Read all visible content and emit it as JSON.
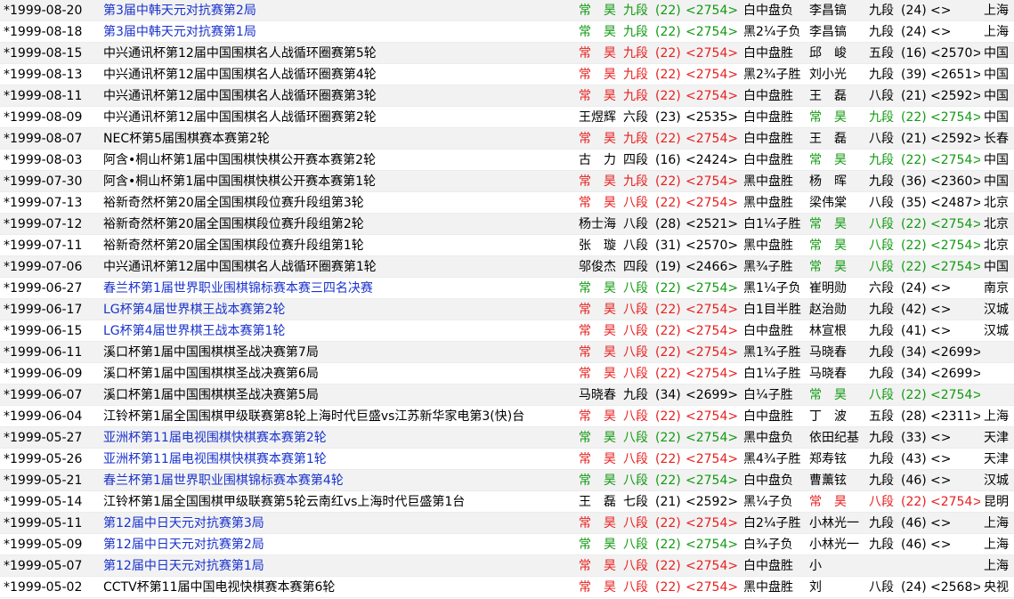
{
  "colors": {
    "link": "#1a33cc",
    "red_highlight": "#e8201f",
    "green_highlight": "#119a11",
    "row_alt": "#f2f2f2"
  },
  "rows": [
    {
      "date": "*1999-08-20",
      "event": "第3届中韩天元对抗赛第2局",
      "link": true,
      "black": {
        "name": "常　昊",
        "rank": "九段",
        "num": "(22)",
        "elo": "<2754>",
        "hl": "green"
      },
      "result": "白中盘负",
      "white": {
        "name": "李昌镐",
        "rank": "九段",
        "num": "(24)",
        "elo": "<>",
        "hl": ""
      },
      "place": "上海"
    },
    {
      "date": "*1999-08-18",
      "event": "第3届中韩天元对抗赛第1局",
      "link": true,
      "black": {
        "name": "常　昊",
        "rank": "九段",
        "num": "(22)",
        "elo": "<2754>",
        "hl": "green"
      },
      "result": "黑2¼子负",
      "white": {
        "name": "李昌镐",
        "rank": "九段",
        "num": "(24)",
        "elo": "<>",
        "hl": ""
      },
      "place": "上海"
    },
    {
      "date": "*1999-08-15",
      "event": "中兴通讯杯第12届中国围棋名人战循环圈赛第5轮",
      "link": false,
      "black": {
        "name": "常　昊",
        "rank": "九段",
        "num": "(22)",
        "elo": "<2754>",
        "hl": "red"
      },
      "result": "白中盘胜",
      "white": {
        "name": "邱　峻",
        "rank": "五段",
        "num": "(16)",
        "elo": "<2570>",
        "hl": ""
      },
      "place": "中国"
    },
    {
      "date": "*1999-08-13",
      "event": "中兴通讯杯第12届中国围棋名人战循环圈赛第4轮",
      "link": false,
      "black": {
        "name": "常　昊",
        "rank": "九段",
        "num": "(22)",
        "elo": "<2754>",
        "hl": "red"
      },
      "result": "黑2¾子胜",
      "white": {
        "name": "刘小光",
        "rank": "九段",
        "num": "(39)",
        "elo": "<2651>",
        "hl": ""
      },
      "place": "中国"
    },
    {
      "date": "*1999-08-11",
      "event": "中兴通讯杯第12届中国围棋名人战循环圈赛第3轮",
      "link": false,
      "black": {
        "name": "常　昊",
        "rank": "九段",
        "num": "(22)",
        "elo": "<2754>",
        "hl": "red"
      },
      "result": "白中盘胜",
      "white": {
        "name": "王　磊",
        "rank": "八段",
        "num": "(21)",
        "elo": "<2592>",
        "hl": ""
      },
      "place": "中国"
    },
    {
      "date": "*1999-08-09",
      "event": "中兴通讯杯第12届中国围棋名人战循环圈赛第2轮",
      "link": false,
      "black": {
        "name": "王煜辉",
        "rank": "六段",
        "num": "(23)",
        "elo": "<2535>",
        "hl": ""
      },
      "result": "白中盘胜",
      "white": {
        "name": "常　昊",
        "rank": "九段",
        "num": "(22)",
        "elo": "<2754>",
        "hl": "green"
      },
      "place": "中国"
    },
    {
      "date": "*1999-08-07",
      "event": "NEC杯第5届围棋赛本赛第2轮",
      "link": false,
      "black": {
        "name": "常　昊",
        "rank": "九段",
        "num": "(22)",
        "elo": "<2754>",
        "hl": "red"
      },
      "result": "白中盘胜",
      "white": {
        "name": "王　磊",
        "rank": "八段",
        "num": "(21)",
        "elo": "<2592>",
        "hl": ""
      },
      "place": "长春"
    },
    {
      "date": "*1999-08-03",
      "event": "阿含•桐山杯第1届中国围棋快棋公开赛本赛第2轮",
      "link": false,
      "black": {
        "name": "古　力",
        "rank": "四段",
        "num": "(16)",
        "elo": "<2424>",
        "hl": ""
      },
      "result": "白中盘胜",
      "white": {
        "name": "常　昊",
        "rank": "九段",
        "num": "(22)",
        "elo": "<2754>",
        "hl": "green"
      },
      "place": "中国"
    },
    {
      "date": "*1999-07-30",
      "event": "阿含•桐山杯第1届中国围棋快棋公开赛本赛第1轮",
      "link": false,
      "black": {
        "name": "常　昊",
        "rank": "九段",
        "num": "(22)",
        "elo": "<2754>",
        "hl": "red"
      },
      "result": "黑中盘胜",
      "white": {
        "name": "杨　晖",
        "rank": "九段",
        "num": "(36)",
        "elo": "<2360>",
        "hl": ""
      },
      "place": "中国"
    },
    {
      "date": "*1999-07-13",
      "event": "裕新奇然杯第20届全国围棋段位赛升段组第3轮",
      "link": false,
      "black": {
        "name": "常　昊",
        "rank": "八段",
        "num": "(22)",
        "elo": "<2754>",
        "hl": "red"
      },
      "result": "黑中盘胜",
      "white": {
        "name": "梁伟棠",
        "rank": "八段",
        "num": "(35)",
        "elo": "<2487>",
        "hl": ""
      },
      "place": "北京"
    },
    {
      "date": "*1999-07-12",
      "event": "裕新奇然杯第20届全国围棋段位赛升段组第2轮",
      "link": false,
      "black": {
        "name": "杨士海",
        "rank": "八段",
        "num": "(28)",
        "elo": "<2521>",
        "hl": ""
      },
      "result": "白1¼子胜",
      "white": {
        "name": "常　昊",
        "rank": "八段",
        "num": "(22)",
        "elo": "<2754>",
        "hl": "green"
      },
      "place": "北京"
    },
    {
      "date": "*1999-07-11",
      "event": "裕新奇然杯第20届全国围棋段位赛升段组第1轮",
      "link": false,
      "black": {
        "name": "张　璇",
        "rank": "八段",
        "num": "(31)",
        "elo": "<2570>",
        "hl": ""
      },
      "result": "黑中盘胜",
      "white": {
        "name": "常　昊",
        "rank": "八段",
        "num": "(22)",
        "elo": "<2754>",
        "hl": "green"
      },
      "place": "北京"
    },
    {
      "date": "*1999-07-06",
      "event": "中兴通讯杯第12届中国围棋名人战循环圈赛第1轮",
      "link": false,
      "black": {
        "name": "邬俊杰",
        "rank": "四段",
        "num": "(19)",
        "elo": "<2466>",
        "hl": ""
      },
      "result": "黑¾子胜",
      "white": {
        "name": "常　昊",
        "rank": "八段",
        "num": "(22)",
        "elo": "<2754>",
        "hl": "green"
      },
      "place": "中国"
    },
    {
      "date": "*1999-06-27",
      "event": "春兰杯第1届世界职业围棋锦标赛本赛三四名决赛",
      "link": true,
      "black": {
        "name": "常　昊",
        "rank": "八段",
        "num": "(22)",
        "elo": "<2754>",
        "hl": "green"
      },
      "result": "黑1¼子负",
      "white": {
        "name": "崔明勋",
        "rank": "六段",
        "num": "(24)",
        "elo": "<>",
        "hl": ""
      },
      "place": "南京"
    },
    {
      "date": "*1999-06-17",
      "event": "LG杯第4届世界棋王战本赛第2轮",
      "link": true,
      "black": {
        "name": "常　昊",
        "rank": "八段",
        "num": "(22)",
        "elo": "<2754>",
        "hl": "red"
      },
      "result": "白1目半胜",
      "white": {
        "name": "赵治勋",
        "rank": "九段",
        "num": "(42)",
        "elo": "<>",
        "hl": ""
      },
      "place": "汉城"
    },
    {
      "date": "*1999-06-15",
      "event": "LG杯第4届世界棋王战本赛第1轮",
      "link": true,
      "black": {
        "name": "常　昊",
        "rank": "八段",
        "num": "(22)",
        "elo": "<2754>",
        "hl": "red"
      },
      "result": "白中盘胜",
      "white": {
        "name": "林宣根",
        "rank": "九段",
        "num": "(41)",
        "elo": "<>",
        "hl": ""
      },
      "place": "汉城"
    },
    {
      "date": "*1999-06-11",
      "event": "溪口杯第1届中国围棋棋圣战决赛第7局",
      "link": false,
      "black": {
        "name": "常　昊",
        "rank": "八段",
        "num": "(22)",
        "elo": "<2754>",
        "hl": "red"
      },
      "result": "黑1¾子胜",
      "white": {
        "name": "马晓春",
        "rank": "九段",
        "num": "(34)",
        "elo": "<2699>",
        "hl": ""
      },
      "place": ""
    },
    {
      "date": "*1999-06-09",
      "event": "溪口杯第1届中国围棋棋圣战决赛第6局",
      "link": false,
      "black": {
        "name": "常　昊",
        "rank": "八段",
        "num": "(22)",
        "elo": "<2754>",
        "hl": "red"
      },
      "result": "白1¼子胜",
      "white": {
        "name": "马晓春",
        "rank": "九段",
        "num": "(34)",
        "elo": "<2699>",
        "hl": ""
      },
      "place": ""
    },
    {
      "date": "*1999-06-07",
      "event": "溪口杯第1届中国围棋棋圣战决赛第5局",
      "link": false,
      "black": {
        "name": "马晓春",
        "rank": "九段",
        "num": "(34)",
        "elo": "<2699>",
        "hl": ""
      },
      "result": "白¼子胜",
      "white": {
        "name": "常　昊",
        "rank": "八段",
        "num": "(22)",
        "elo": "<2754>",
        "hl": "green"
      },
      "place": ""
    },
    {
      "date": "*1999-06-04",
      "event": "江铃杯第1届全国围棋甲级联赛第8轮上海时代巨盛vs江苏新华家电第3(快)台",
      "link": false,
      "black": {
        "name": "常　昊",
        "rank": "八段",
        "num": "(22)",
        "elo": "<2754>",
        "hl": "red"
      },
      "result": "白中盘胜",
      "white": {
        "name": "丁　波",
        "rank": "五段",
        "num": "(28)",
        "elo": "<2311>",
        "hl": ""
      },
      "place": "上海"
    },
    {
      "date": "*1999-05-27",
      "event": "亚洲杯第11届电视围棋快棋赛本赛第2轮",
      "link": true,
      "black": {
        "name": "常　昊",
        "rank": "八段",
        "num": "(22)",
        "elo": "<2754>",
        "hl": "green"
      },
      "result": "黑中盘负",
      "white": {
        "name": "依田纪基",
        "rank": "九段",
        "num": "(33)",
        "elo": "<>",
        "hl": ""
      },
      "place": "天津"
    },
    {
      "date": "*1999-05-26",
      "event": "亚洲杯第11届电视围棋快棋赛本赛第1轮",
      "link": true,
      "black": {
        "name": "常　昊",
        "rank": "八段",
        "num": "(22)",
        "elo": "<2754>",
        "hl": "red"
      },
      "result": "黑4¾子胜",
      "white": {
        "name": "郑寿铉",
        "rank": "九段",
        "num": "(43)",
        "elo": "<>",
        "hl": ""
      },
      "place": "天津"
    },
    {
      "date": "*1999-05-21",
      "event": "春兰杯第1届世界职业围棋锦标赛本赛第4轮",
      "link": true,
      "black": {
        "name": "常　昊",
        "rank": "八段",
        "num": "(22)",
        "elo": "<2754>",
        "hl": "green"
      },
      "result": "白中盘负",
      "white": {
        "name": "曹薰铉",
        "rank": "九段",
        "num": "(46)",
        "elo": "<>",
        "hl": ""
      },
      "place": "汉城"
    },
    {
      "date": "*1999-05-14",
      "event": "江铃杯第1届全国围棋甲级联赛第5轮云南红vs上海时代巨盛第1台",
      "link": false,
      "black": {
        "name": "王　磊",
        "rank": "七段",
        "num": "(21)",
        "elo": "<2592>",
        "hl": ""
      },
      "result": "黑¼子负",
      "white": {
        "name": "常　昊",
        "rank": "八段",
        "num": "(22)",
        "elo": "<2754>",
        "hl": "red"
      },
      "place": "昆明"
    },
    {
      "date": "*1999-05-11",
      "event": "第12届中日天元对抗赛第3局",
      "link": true,
      "black": {
        "name": "常　昊",
        "rank": "八段",
        "num": "(22)",
        "elo": "<2754>",
        "hl": "red"
      },
      "result": "白2¼子胜",
      "white": {
        "name": "小林光一",
        "rank": "九段",
        "num": "(46)",
        "elo": "<>",
        "hl": ""
      },
      "place": "上海"
    },
    {
      "date": "*1999-05-09",
      "event": "第12届中日天元对抗赛第2局",
      "link": true,
      "black": {
        "name": "常　昊",
        "rank": "八段",
        "num": "(22)",
        "elo": "<2754>",
        "hl": "green"
      },
      "result": "白¾子负",
      "white": {
        "name": "小林光一",
        "rank": "九段",
        "num": "(46)",
        "elo": "<>",
        "hl": ""
      },
      "place": "上海"
    },
    {
      "date": "*1999-05-07",
      "event": "第12届中日天元对抗赛第1局",
      "link": true,
      "black": {
        "name": "常　昊",
        "rank": "八段",
        "num": "(22)",
        "elo": "<2754>",
        "hl": "red"
      },
      "result": "白中盘胜",
      "white": {
        "name": "小",
        "rank": "",
        "num": "",
        "elo": "",
        "hl": ""
      },
      "place": "上海"
    },
    {
      "date": "*1999-05-02",
      "event": "CCTV杯第11届中国电视快棋赛本赛第6轮",
      "link": false,
      "black": {
        "name": "常　昊",
        "rank": "八段",
        "num": "(22)",
        "elo": "<2754>",
        "hl": "red"
      },
      "result": "黑中盘胜",
      "white": {
        "name": "刘",
        "rank": "八段",
        "num": "(24)",
        "elo": "<2568>",
        "hl": ""
      },
      "place": "央视"
    }
  ]
}
